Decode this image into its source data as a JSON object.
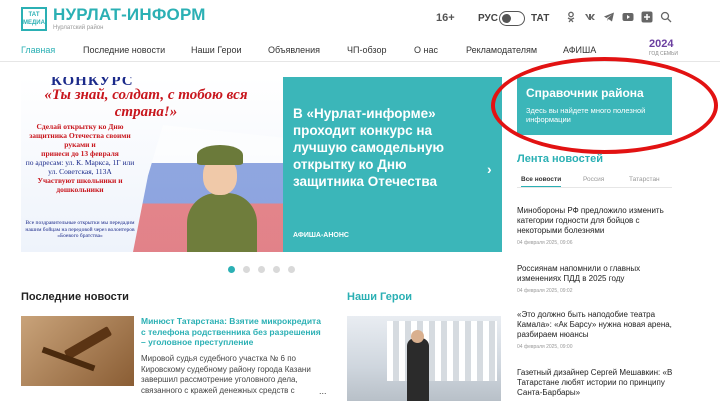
{
  "header": {
    "logo_line1": "ТАТ",
    "logo_line2": "МЕДИА",
    "site_name": "НУРЛАТ-ИНФОРМ",
    "site_subtitle": "Нурлатский район",
    "age_rating": "16+",
    "lang_ru": "РУС",
    "lang_tat": "ТАТ",
    "social_icons": [
      "ok-icon",
      "vk-icon",
      "telegram-icon",
      "youtube-icon",
      "plus-icon",
      "search-icon"
    ]
  },
  "nav": {
    "items": [
      "Главная",
      "Последние новости",
      "Наши Герои",
      "Объявления",
      "ЧП-обзор",
      "О нас",
      "Рекламодателям",
      "АФИША"
    ],
    "year_badge": "2024",
    "year_badge_sub": "ГОД СЕМЬИ"
  },
  "slider": {
    "poster_title": "КОНКУРС",
    "poster_slogan": "«Ты знай, солдат, с тобою вся страна!»",
    "poster_text_1": "Сделай открытку ко Дню защитника Отечества своими руками и",
    "poster_text_2": "принеси до 13 февраля",
    "poster_text_3": "по адресам: ул. К. Маркса, 1Г или ул. Советская, 113А",
    "poster_text_4": "Участвуют школьники и дошкольники",
    "poster_small": "Все поздравительные открытки мы передадим нашим бойцам на передовой через волонтеров «Боевого братства»",
    "headline": "В «Нурлат-информе» проходит конкурс на лучшую самодельную открытку ко Дню защитника Отечества",
    "category": "АФИША-АНОНС",
    "arrow": "›",
    "dots_count": 5,
    "active_dot": 0
  },
  "sidebar": {
    "sprav_title": "Справочник района",
    "sprav_desc": "Здесь вы найдете много полезной информации",
    "lenta_title": "Лента новостей",
    "tabs": [
      "Все новости",
      "Россия",
      "Татарстан"
    ],
    "news": [
      {
        "title": "Минобороны РФ предложило изменить категории годности для бойцов с некоторыми болезнями",
        "time": "04 февраля 2025, 09:06"
      },
      {
        "title": "Россиянам напомнили о главных изменениях ПДД в 2025 году",
        "time": "04 февраля 2025, 09:02"
      },
      {
        "title": "«Это должно быть наподобие театра Камала»: «Ак Барсу» нужна новая арена, разбираем нюансы",
        "time": "04 февраля 2025, 09:00"
      },
      {
        "title": "Газетный дизайнер Сергей Мешавкин: «В Татарстане любят истории по принципу Санта-Барбары»",
        "time": ""
      }
    ]
  },
  "latest": {
    "section_title": "Последние новости",
    "news_title": "Минюст Татарстана: Взятие микрокредита с телефона родственника без разрешения – уголовное преступление",
    "news_text": "Мировой судья судебного участка № 6 по Кировскому судебному району города Казани завершил рассмотрение уголовного дела, связанного с кражей денежных средств с",
    "more": "..."
  },
  "heroes": {
    "section_title": "Наши Герои"
  }
}
